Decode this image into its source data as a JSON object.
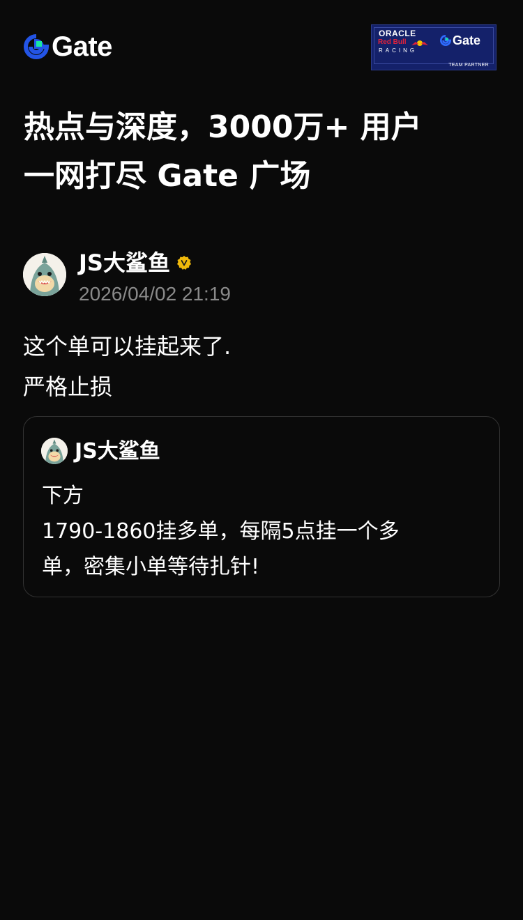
{
  "header": {
    "logo_text": "Gate",
    "partner_badge": {
      "oracle": "ORACLE",
      "redbull": "Red Bull",
      "racing": "RACING",
      "gate": "Gate",
      "team_partner": "TEAM PARTNER"
    }
  },
  "headline": {
    "line1": "热点与深度，3000万+ 用户",
    "line2": "一网打尽 Gate 广场"
  },
  "post": {
    "author_name": "JS大鲨鱼",
    "verified_icon": "verified-badge-icon",
    "timestamp": "2026/04/02 21:19",
    "body_lines": [
      "这个单可以挂起来了.",
      "严格止损"
    ]
  },
  "quoted_post": {
    "author_name": "JS大鲨鱼",
    "body_lines": [
      "下方",
      "1790-1860挂多单，每隔5点挂一个多",
      "单，密集小单等待扎针!"
    ]
  },
  "colors": {
    "background": "#0a0a0a",
    "brand_blue": "#2354e6",
    "brand_green": "#17e6a1",
    "timestamp_gray": "#8a8a8a",
    "verified_gold": "#f0b90b",
    "card_border": "#333333"
  }
}
